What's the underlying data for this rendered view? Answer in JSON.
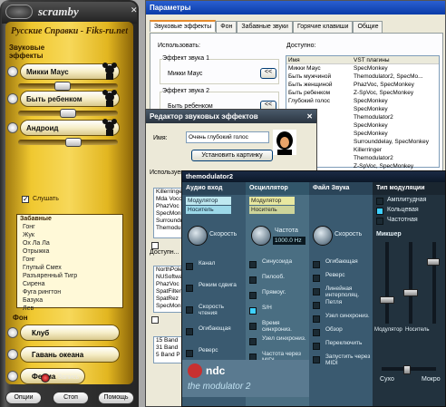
{
  "scramby": {
    "logo": "scramby",
    "banner": "Русские Справки - Fiks-ru.net",
    "voice_effects_label": "Звуковые эффекты",
    "voices": [
      {
        "label": "Микки Маус"
      },
      {
        "label": "Быть ребенком"
      },
      {
        "label": "Андроид"
      }
    ],
    "listen_label": "Слушать",
    "fun_header": "Забавные",
    "fun_list": [
      "Гонг",
      "Жук",
      "Ох Ла Ла",
      "Отрыжка",
      "Гонг",
      "Глупый Смех",
      "Разъяренный Тигр",
      "Сирена",
      "Фуга рингтон",
      "Базука",
      "Лев"
    ],
    "background_label": "Фон",
    "backgrounds": [
      "Клуб",
      "Гавань океана",
      "Ферма"
    ],
    "record_label": "Запись",
    "buttons": {
      "options": "Опции",
      "stop": "Стоп",
      "help": "Помощь"
    }
  },
  "params": {
    "title": "Параметры",
    "tabs": [
      "Звуковые эффекты",
      "Фон",
      "Забавные звуки",
      "Горячие клавиши",
      "Общие"
    ],
    "active_tab": 0,
    "use_label": "Использовать:",
    "available_label": "Доступно:",
    "effect1_label": "Эффект звука 1",
    "effect1_value": "Микки Маус",
    "effect2_label": "Эффект звука 2",
    "effect2_value": "Быть ребенком",
    "move_btn": "<<",
    "table_headers": [
      "Имя",
      "VST плагины"
    ],
    "table_rows": [
      [
        "Микки Маус",
        "SpecMonkey"
      ],
      [
        "Быть мужчиной",
        "Themodulator2, SpecMo..."
      ],
      [
        "Быть женщиной",
        "PhazVoc, SpecMonkey"
      ],
      [
        "Быть ребенком",
        "Z-SpVoc, SpecMonkey"
      ],
      [
        "Глубокий голос",
        "SpecMonkey"
      ],
      [
        "",
        "SpecMonkey"
      ],
      [
        "",
        "Themodulator2"
      ],
      [
        "",
        "SpecMonkey"
      ],
      [
        "детей",
        "SpecMonkey"
      ],
      [
        "",
        "Surrounddelay, SpecMonkey"
      ],
      [
        "",
        "Killerringer"
      ],
      [
        "помехи",
        "Themodulator2"
      ],
      [
        "",
        "Z-SpVoc, SpecMonkey"
      ],
      [
        "",
        "Themodulator2, SpecMo..."
      ]
    ]
  },
  "editor": {
    "title": "Редактор звуковых эффектов",
    "name_label": "Имя:",
    "name_value": "Очень глубокий голос",
    "set_picture_btn": "Установить картинку",
    "used_label": "Используемые",
    "available_label": "Доступн...",
    "used_list": [
      "Killerringer",
      "Mda Vocoder",
      "PhazVoc",
      "SpecMonkey",
      "Surrounddelay",
      "Themodulator2"
    ],
    "available_list": [
      "NorthPole",
      "NUSoftware",
      "PhazVoc",
      "SpatFilter",
      "SpatRez",
      "SpecMonkey"
    ],
    "bands": [
      "15 Band",
      "31 Band",
      "5 Band P"
    ]
  },
  "themodulator": {
    "title": "themodulator2",
    "columns": [
      {
        "header": "Аудио вход",
        "lcd": [
          "Модулятор",
          "Носитель"
        ],
        "knob_label": "Скорость",
        "buttons": [
          "Канал",
          "Режим сдвига",
          "Скорость чтения",
          "Огибающая",
          "Реверс"
        ]
      },
      {
        "header": "Осциллятор",
        "lcd": [
          "Модулятор",
          "Носитель"
        ],
        "knob_label": "Частота",
        "freq": "1000.0 Hz",
        "buttons": [
          "Синусоида",
          "Пилооб.",
          "Прямоуг.",
          "S/H",
          "Время синхрониз.",
          "Узел синхрониз.",
          "Частота через MIDI"
        ]
      },
      {
        "header": "Файл Звука",
        "knob_label": "Скорость",
        "buttons": [
          "Огибающая",
          "Реверс",
          "Линейная интерполяц.",
          "Петля",
          "Узел синхрониз.",
          "Обзор",
          "Переключить",
          "Запустить через MIDI"
        ]
      },
      {
        "header": "Тип модуляции",
        "options": [
          "Амплитудная",
          "Кольцевая",
          "Частотная"
        ],
        "selected": 1,
        "mixer_label": "Микшер",
        "fader_labels": [
          "Модулятор",
          "Носитель"
        ],
        "dry_wet": [
          "Сухо",
          "Мокро"
        ]
      }
    ],
    "brand": "ndc",
    "brand_sub": "the modulator 2"
  },
  "colors": {
    "gold": "#f0c830",
    "xp_title": "#0a3ca8",
    "mod_bg": "#2a3a48",
    "accent_cyan": "#3fd0ff"
  }
}
